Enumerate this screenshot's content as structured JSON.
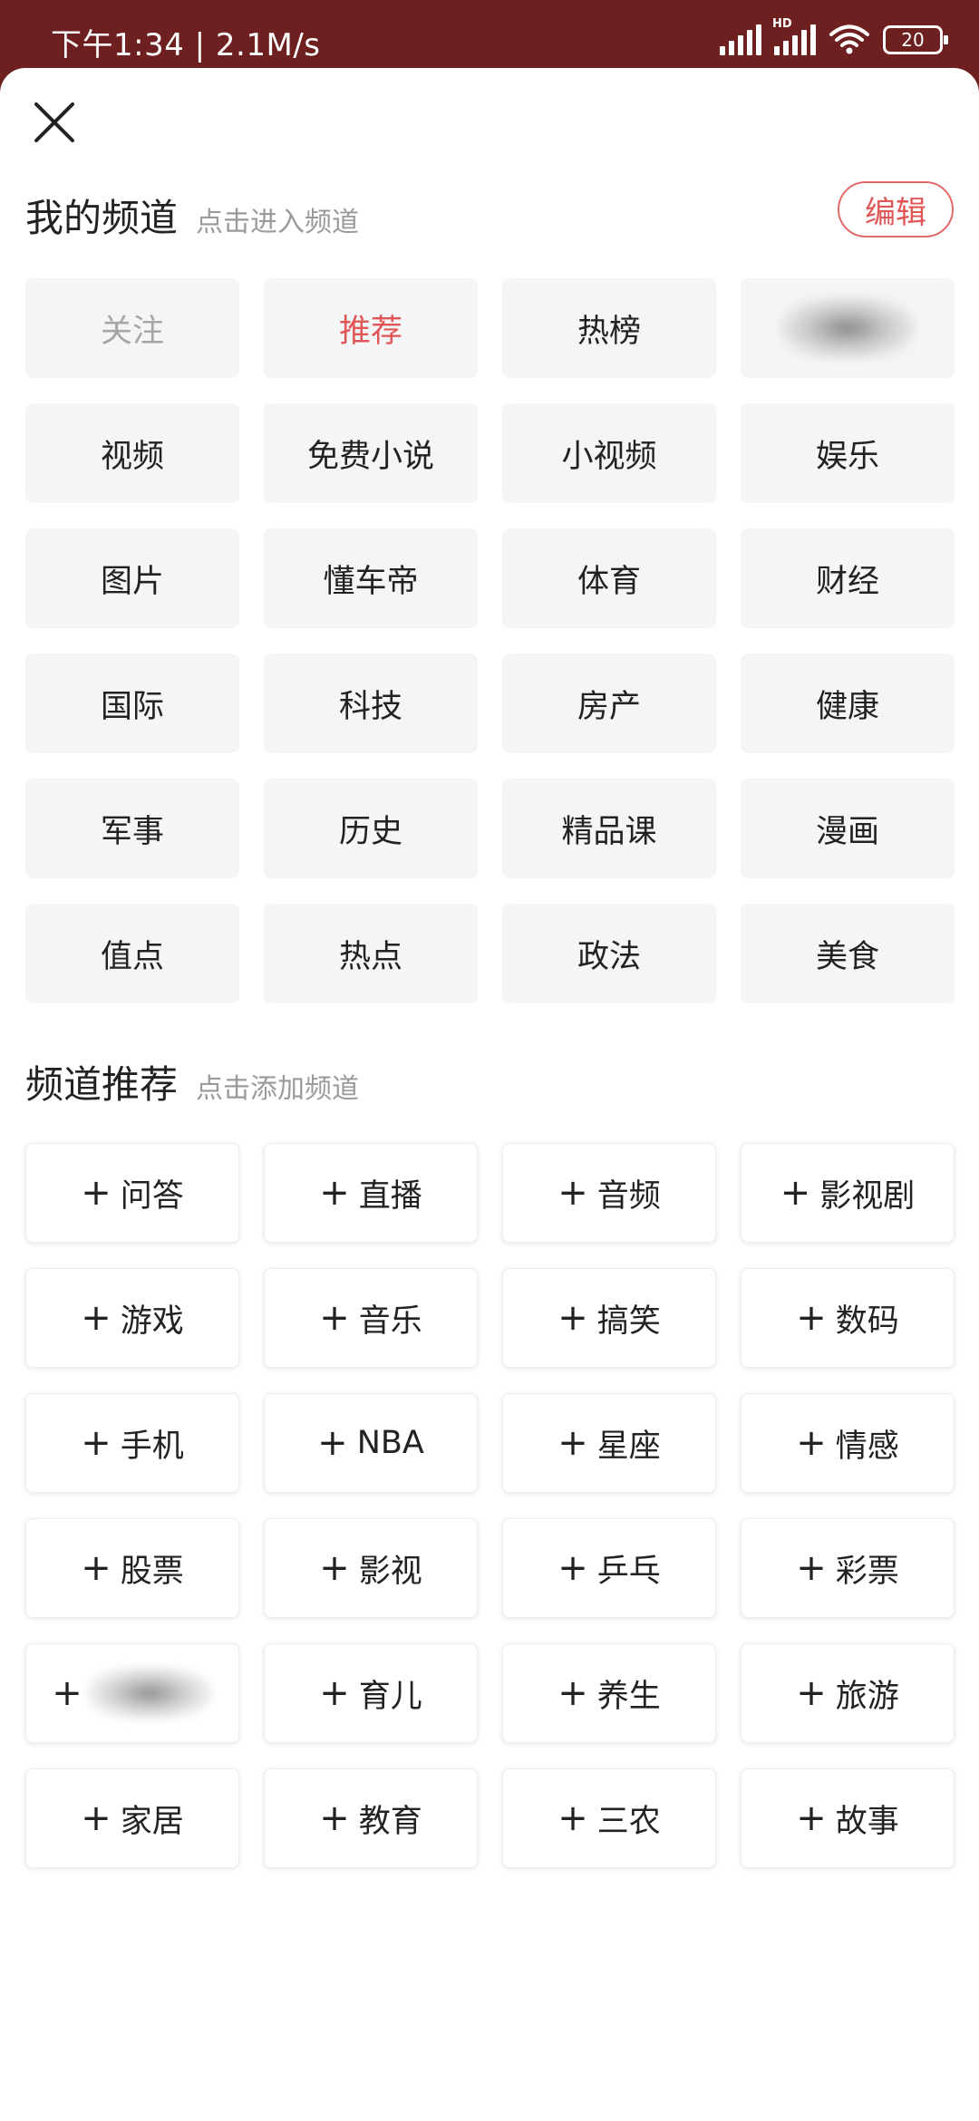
{
  "status": {
    "time": "下午1:34 | 2.1M/s",
    "network_badge": "HD",
    "battery": "20"
  },
  "my_channels": {
    "title": "我的频道",
    "subtitle": "点击进入频道",
    "edit_label": "编辑",
    "items": [
      {
        "label": "关注",
        "state": "fixed"
      },
      {
        "label": "推荐",
        "state": "active"
      },
      {
        "label": "热榜",
        "state": "normal"
      },
      {
        "label": "",
        "state": "obscured"
      },
      {
        "label": "视频",
        "state": "normal"
      },
      {
        "label": "免费小说",
        "state": "normal"
      },
      {
        "label": "小视频",
        "state": "normal"
      },
      {
        "label": "娱乐",
        "state": "normal"
      },
      {
        "label": "图片",
        "state": "normal"
      },
      {
        "label": "懂车帝",
        "state": "normal"
      },
      {
        "label": "体育",
        "state": "normal"
      },
      {
        "label": "财经",
        "state": "normal"
      },
      {
        "label": "国际",
        "state": "normal"
      },
      {
        "label": "科技",
        "state": "normal"
      },
      {
        "label": "房产",
        "state": "normal"
      },
      {
        "label": "健康",
        "state": "normal"
      },
      {
        "label": "军事",
        "state": "normal"
      },
      {
        "label": "历史",
        "state": "normal"
      },
      {
        "label": "精品课",
        "state": "normal"
      },
      {
        "label": "漫画",
        "state": "normal"
      },
      {
        "label": "值点",
        "state": "normal"
      },
      {
        "label": "热点",
        "state": "normal"
      },
      {
        "label": "政法",
        "state": "normal"
      },
      {
        "label": "美食",
        "state": "normal"
      }
    ]
  },
  "recommended": {
    "title": "频道推荐",
    "subtitle": "点击添加频道",
    "plus_symbol": "+",
    "items": [
      {
        "label": "问答"
      },
      {
        "label": "直播"
      },
      {
        "label": "音频"
      },
      {
        "label": "影视剧"
      },
      {
        "label": "游戏"
      },
      {
        "label": "音乐"
      },
      {
        "label": "搞笑"
      },
      {
        "label": "数码"
      },
      {
        "label": "手机"
      },
      {
        "label": "NBA"
      },
      {
        "label": "星座"
      },
      {
        "label": "情感"
      },
      {
        "label": "股票"
      },
      {
        "label": "影视"
      },
      {
        "label": "乒乓"
      },
      {
        "label": "彩票"
      },
      {
        "label": "",
        "obscured": true
      },
      {
        "label": "育儿"
      },
      {
        "label": "养生"
      },
      {
        "label": "旅游"
      },
      {
        "label": "家居"
      },
      {
        "label": "教育"
      },
      {
        "label": "三农"
      },
      {
        "label": "故事"
      }
    ]
  },
  "colors": {
    "statusbar_bg": "#6e1f20",
    "accent": "#e05656",
    "tile_bg": "#f4f5f6",
    "muted_text": "#9a9a9a"
  }
}
